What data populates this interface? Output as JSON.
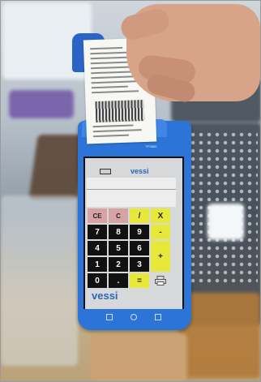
{
  "device": {
    "model_label": "TPS880",
    "brand_top": "vessi",
    "brand_bottom": "vessi"
  },
  "keypad": {
    "row1": [
      "CE",
      "C",
      "/",
      "X"
    ],
    "row2": [
      "7",
      "8",
      "9",
      "-"
    ],
    "row3": [
      "4",
      "5",
      "6",
      "+"
    ],
    "row4": [
      "1",
      "2",
      "3",
      ""
    ],
    "row5": [
      "0",
      ".",
      "=",
      ""
    ]
  },
  "colors": {
    "device_blue": "#2d74d9",
    "key_black": "#111111",
    "key_yellow": "#e8e83a",
    "key_pink": "#d8a3a5"
  }
}
